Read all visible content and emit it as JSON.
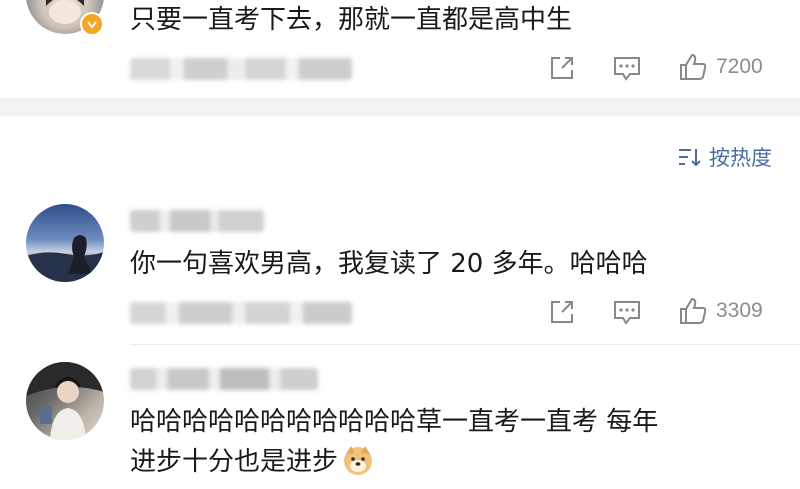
{
  "comments": [
    {
      "text": "只要一直考下去，那就一直都是高中生",
      "likes": "7200"
    },
    {
      "text": "你一句喜欢男高，我复读了 20 多年。哈哈哈",
      "likes": "3309"
    },
    {
      "text_line1": "哈哈哈哈哈哈哈哈哈哈哈草一直考一直考 每年",
      "text_line2": "进步十分也是进步"
    }
  ],
  "sort": {
    "label": "按热度"
  },
  "colors": {
    "accent": "#4a6f9f",
    "verified": "#f5a623",
    "icon_gray": "#888888",
    "separator": "#f2f2f2"
  },
  "icons": [
    "share-icon",
    "comment-icon",
    "like-icon",
    "sort-icon",
    "verified-icon",
    "doge-emoji"
  ]
}
